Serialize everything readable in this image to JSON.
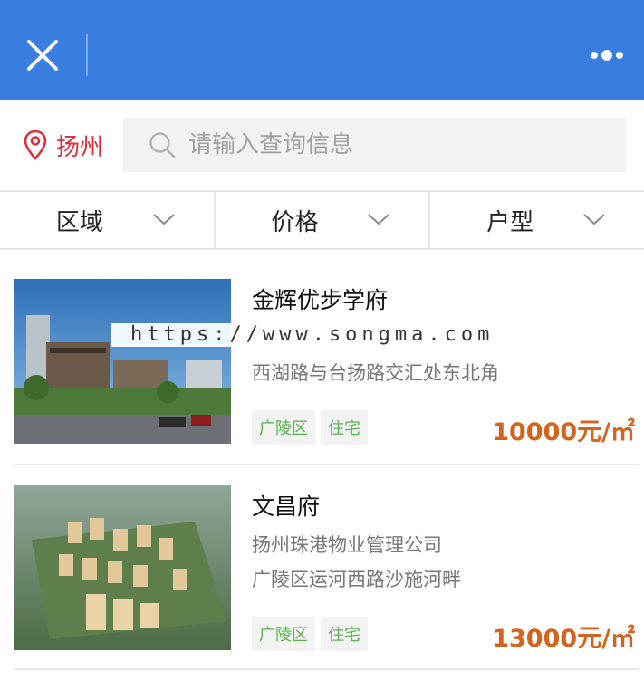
{
  "city": {
    "name": "扬州"
  },
  "search": {
    "placeholder": "请输入查询信息"
  },
  "filters": [
    {
      "label": "区域"
    },
    {
      "label": "价格"
    },
    {
      "label": "户型"
    }
  ],
  "listings": [
    {
      "title": "金辉优步学府",
      "line2": "西湖路与台扬路交汇处东北角",
      "tags": [
        "广陵区",
        "住宅"
      ],
      "price": "10000元/㎡"
    },
    {
      "title": "文昌府",
      "line1": "扬州珠港物业管理公司",
      "line2": "广陵区运河西路沙施河畔",
      "tags": [
        "广陵区",
        "住宅"
      ],
      "price": "13000元/㎡"
    }
  ],
  "watermark": "https://www.songma.com",
  "colors": {
    "topbar": "#3a7de0",
    "city": "#d9303a",
    "tag_text": "#56b34d",
    "price": "#d2641f"
  },
  "icons": {
    "close": "close-icon",
    "more": "more-icon",
    "location": "location-pin-icon",
    "search": "search-icon",
    "chevron": "chevron-down-icon"
  }
}
